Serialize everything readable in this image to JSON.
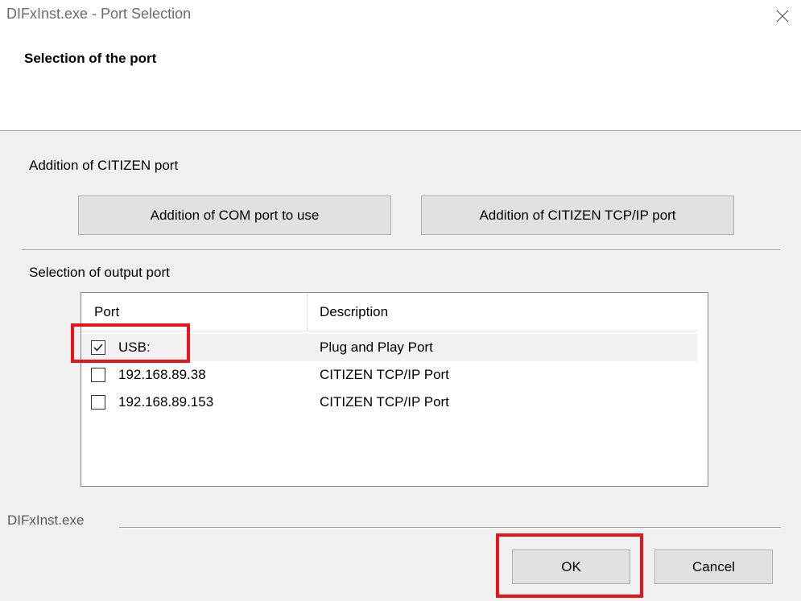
{
  "window": {
    "title": "DIFxInst.exe - Port Selection",
    "close_icon": "close-icon"
  },
  "header": {
    "title": "Selection of the port"
  },
  "citizen_group": {
    "label": "Addition of CITIZEN port",
    "com_button": "Addition of COM port to use",
    "tcpip_button": "Addition of CITIZEN TCP/IP port"
  },
  "output_group": {
    "label": "Selection of output port",
    "columns": [
      "Port",
      "Description"
    ],
    "rows": [
      {
        "port": "USB:",
        "description": "Plug and Play Port",
        "checked": true
      },
      {
        "port": "192.168.89.38",
        "description": "CITIZEN TCP/IP Port",
        "checked": false
      },
      {
        "port": "192.168.89.153",
        "description": "CITIZEN TCP/IP Port",
        "checked": false
      }
    ]
  },
  "footer": {
    "label": "DIFxInst.exe",
    "ok_button": "OK",
    "cancel_button": "Cancel"
  },
  "colors": {
    "highlight": "#e8141c",
    "dialog_bg": "#f0f0f0",
    "button_bg": "#e1e1e1"
  }
}
